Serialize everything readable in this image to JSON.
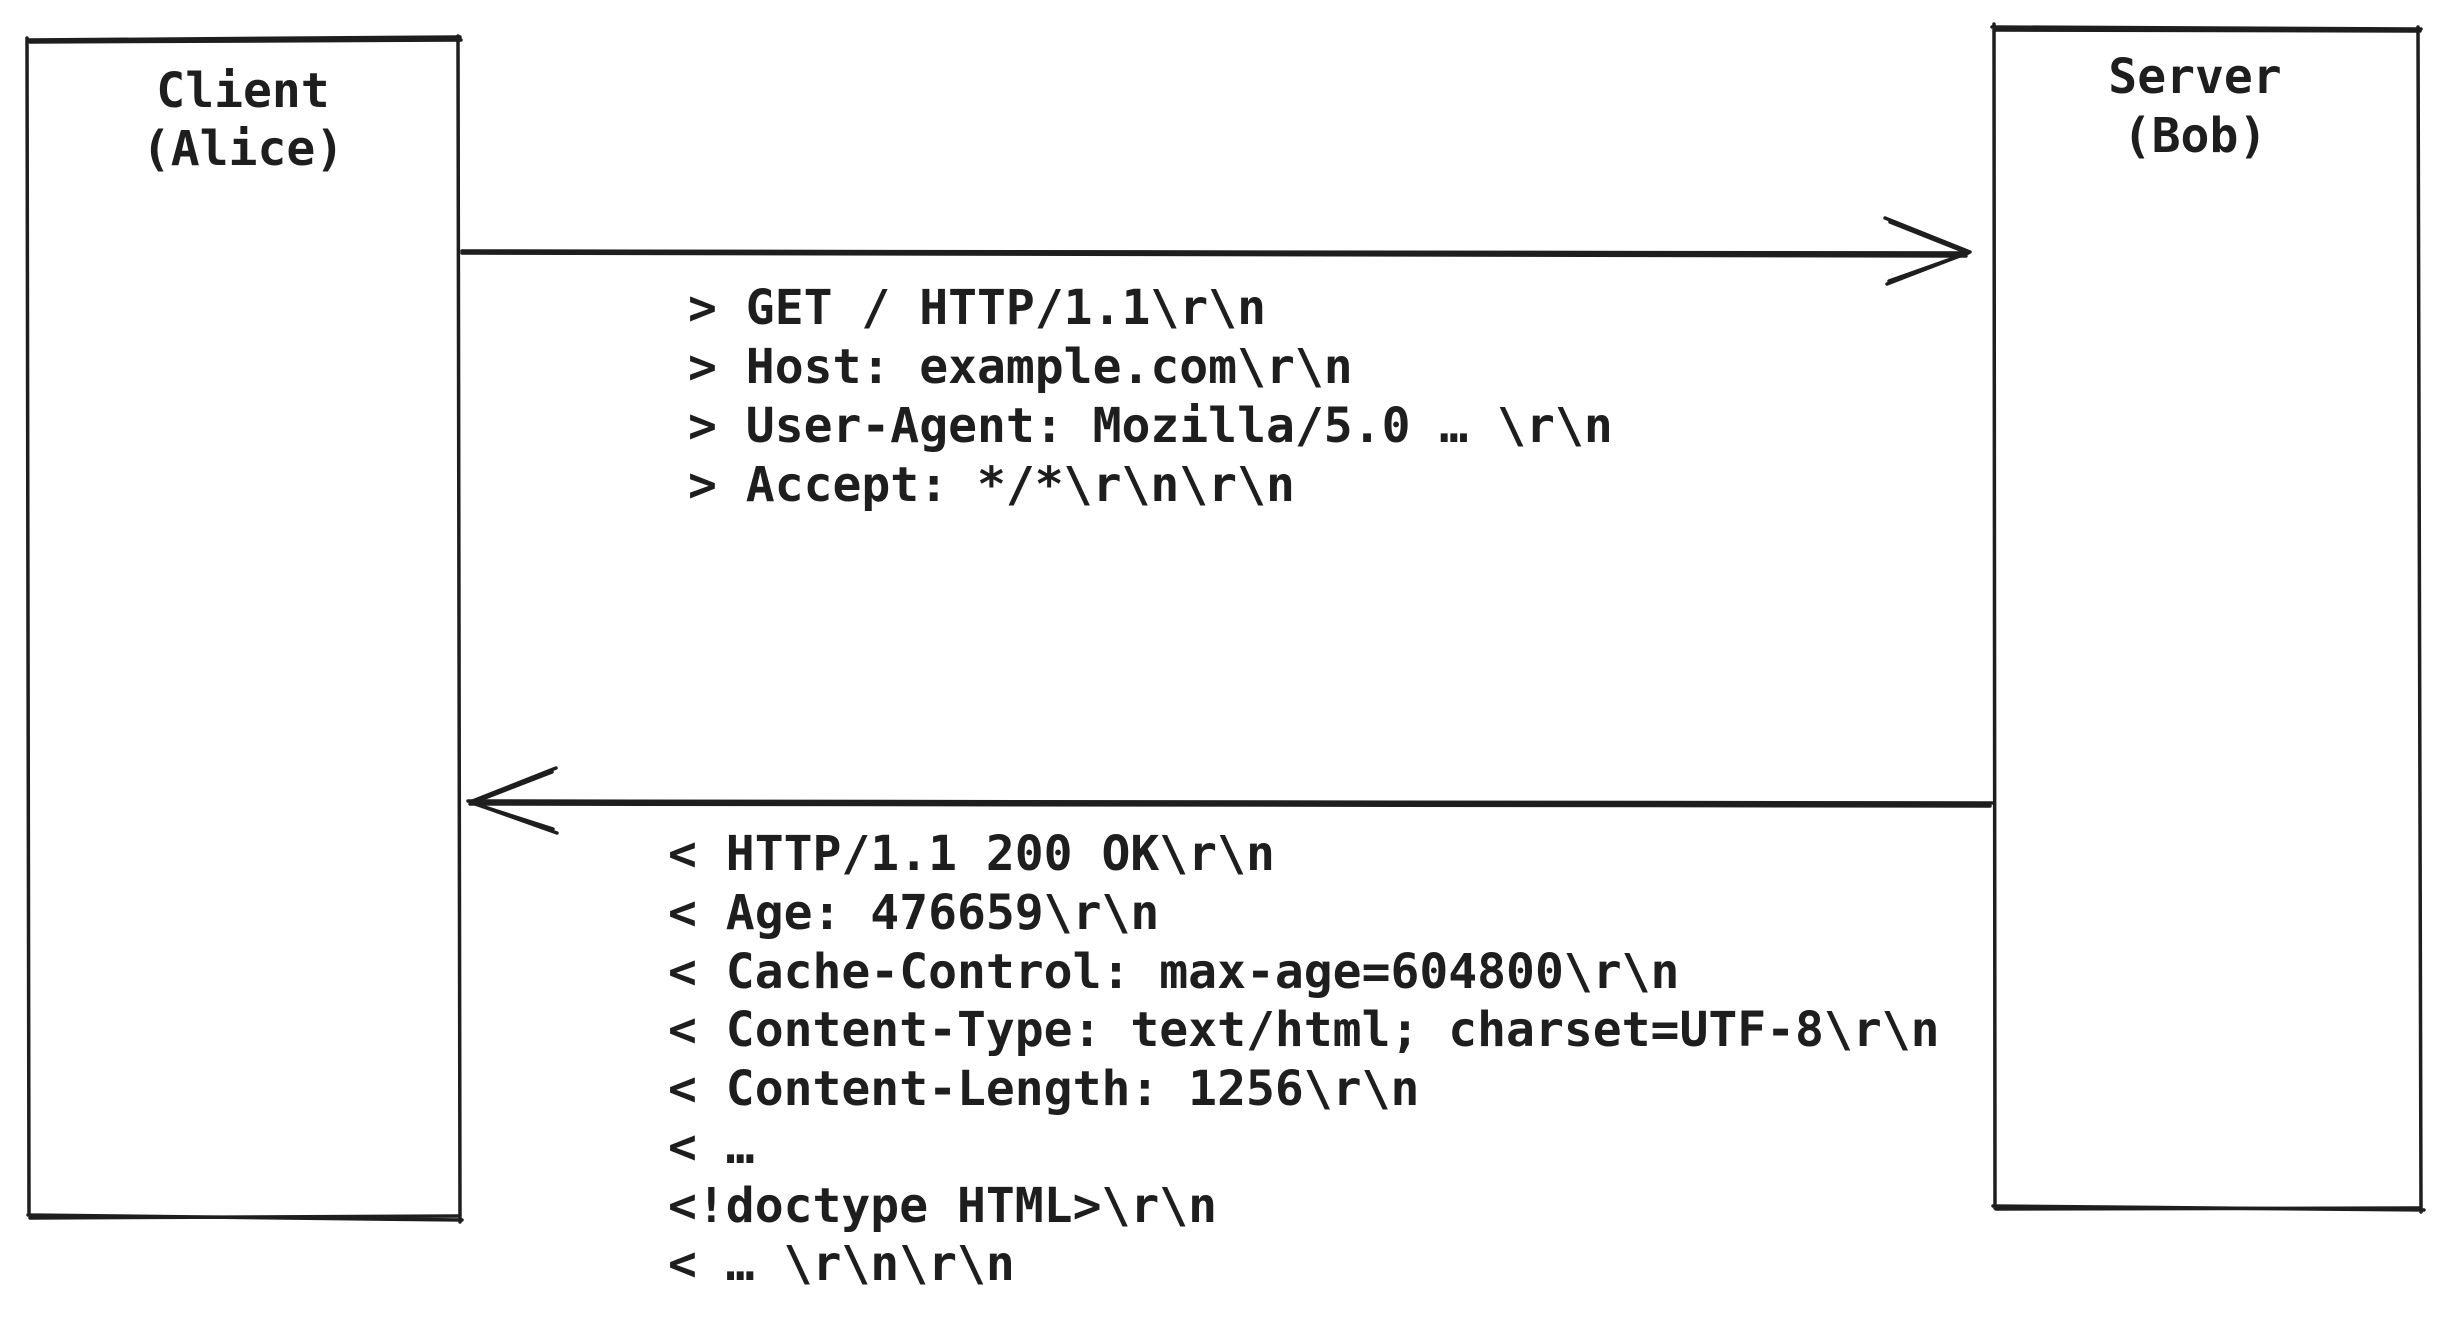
{
  "client": {
    "title_line1": "Client",
    "title_line2": "(Alice)"
  },
  "server": {
    "title_line1": "Server",
    "title_line2": "(Bob)"
  },
  "request": {
    "lines": [
      "> GET / HTTP/1.1\\r\\n",
      "> Host: example.com\\r\\n",
      "> User-Agent: Mozilla/5.0 … \\r\\n",
      "> Accept: */*\\r\\n\\r\\n"
    ]
  },
  "response": {
    "lines": [
      "< HTTP/1.1 200 OK\\r\\n",
      "< Age: 476659\\r\\n",
      "< Cache-Control: max-age=604800\\r\\n",
      "< Content-Type: text/html; charset=UTF-8\\r\\n",
      "< Content-Length: 1256\\r\\n",
      "< …",
      "<!doctype HTML>\\r\\n",
      "< … \\r\\n\\r\\n"
    ]
  }
}
